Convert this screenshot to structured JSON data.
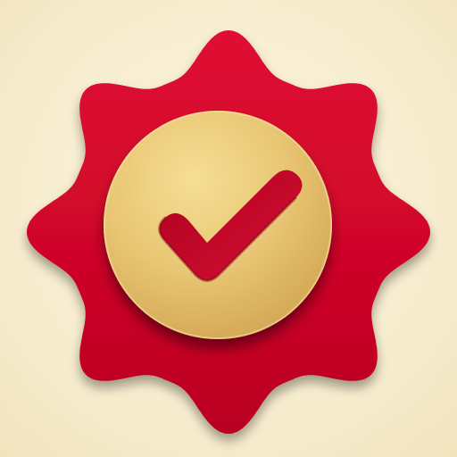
{
  "icon": {
    "name": "verified-badge-checkmark",
    "shape": "wavy-rosette-8-point",
    "elements": [
      "rosette-badge-icon",
      "gold-medallion",
      "checkmark-icon"
    ]
  },
  "colors": {
    "background": "#f6ebcb",
    "badge_red": "#d0062c",
    "badge_red_dark": "#a9001f",
    "gold_light": "#f3d98a",
    "gold_mid": "#e4c06a",
    "gold_dark": "#c99b45",
    "check_red": "#c8102e"
  }
}
